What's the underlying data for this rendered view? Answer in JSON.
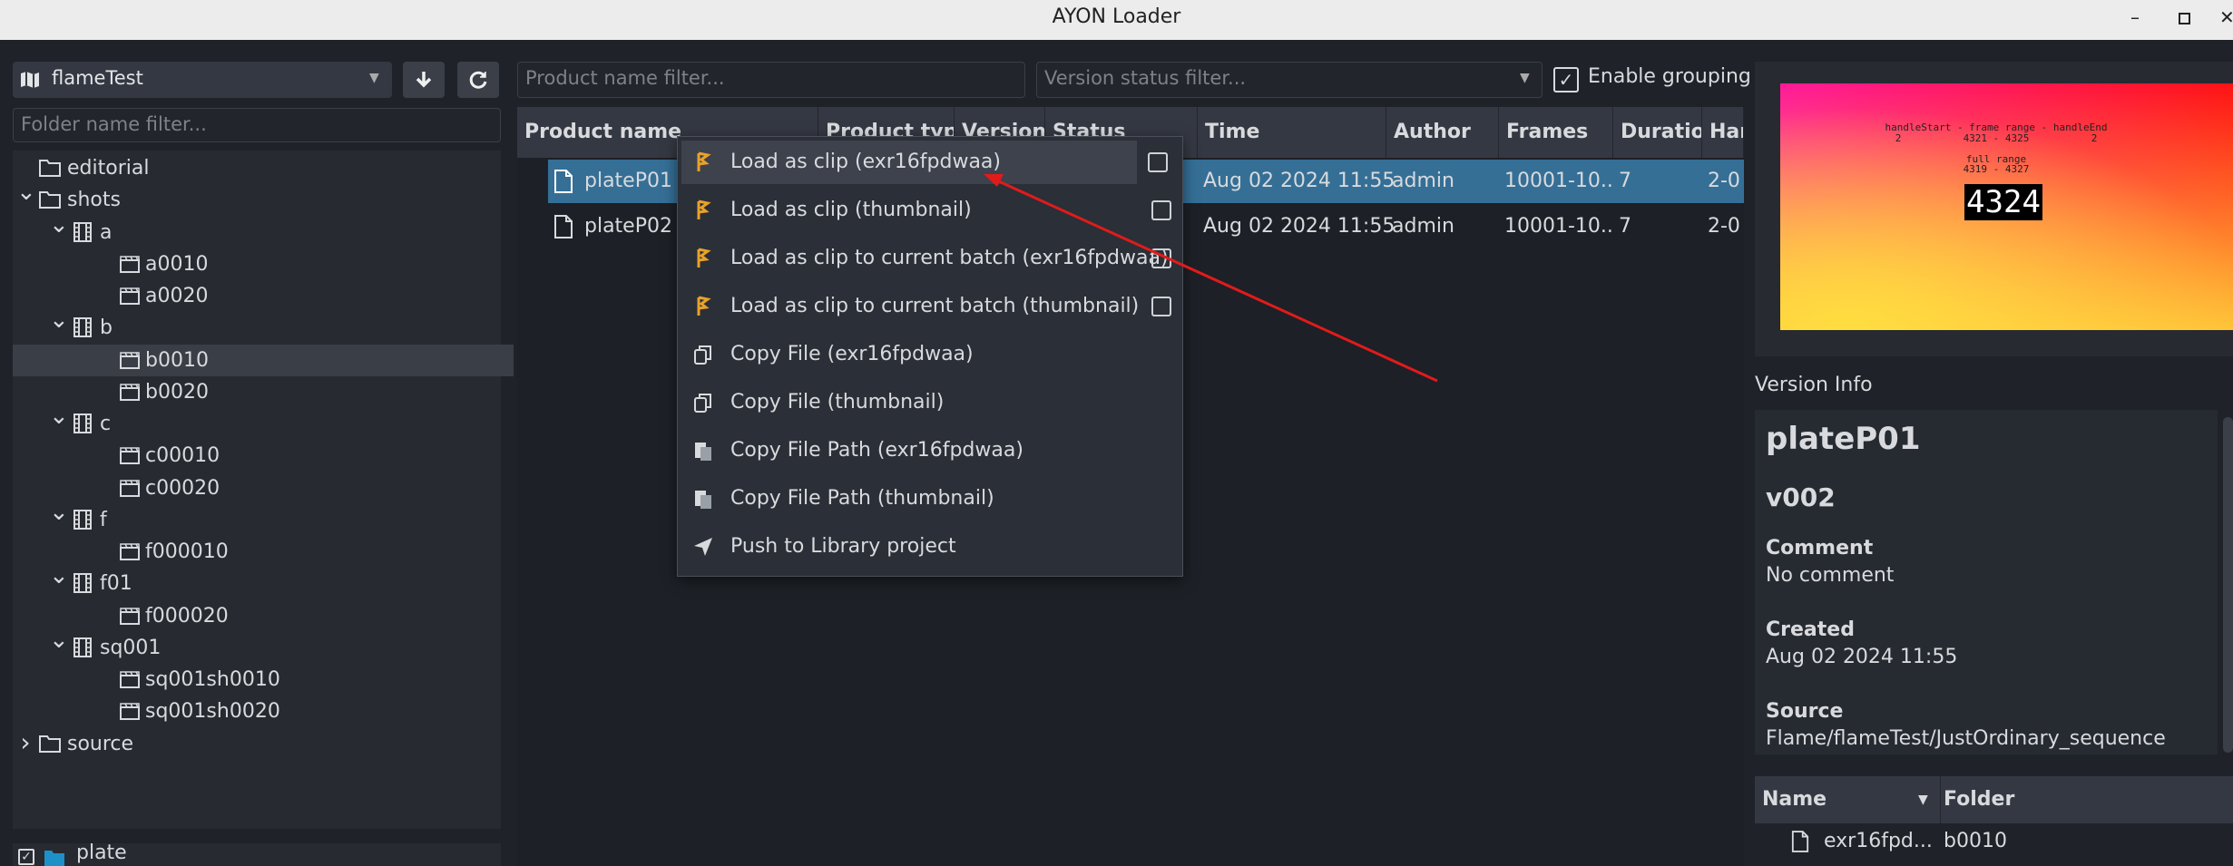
{
  "window": {
    "title": "AYON Loader"
  },
  "left": {
    "project_name": "flameTest",
    "folder_filter_placeholder": "Folder name filter...",
    "tree": [
      {
        "label": "editorial"
      },
      {
        "label": "shots"
      },
      {
        "label": "a"
      },
      {
        "label": "a0010"
      },
      {
        "label": "a0020"
      },
      {
        "label": "b"
      },
      {
        "label": "b0010"
      },
      {
        "label": "b0020"
      },
      {
        "label": "c"
      },
      {
        "label": "c00010"
      },
      {
        "label": "c00020"
      },
      {
        "label": "f"
      },
      {
        "label": "f000010"
      },
      {
        "label": "f01"
      },
      {
        "label": "f000020"
      },
      {
        "label": "sq001"
      },
      {
        "label": "sq001sh0010"
      },
      {
        "label": "sq001sh0020"
      },
      {
        "label": "source"
      }
    ],
    "type_filter": {
      "label": "plate"
    }
  },
  "center": {
    "product_filter_placeholder": "Product name filter...",
    "version_filter_placeholder": "Version status filter...",
    "enable_grouping_label": "Enable grouping",
    "columns": [
      "Product name",
      "Product type",
      "Version",
      "Status",
      "Time",
      "Author",
      "Frames",
      "Duration",
      "Handles"
    ],
    "rows": [
      {
        "name": "plateP01",
        "time": "Aug 02 2024 11:55",
        "author": "admin",
        "frames": "10001-10...",
        "duration": "7",
        "handles": "2-0"
      },
      {
        "name": "plateP02",
        "time": "Aug 02 2024 11:55",
        "author": "admin",
        "frames": "10001-10...",
        "duration": "7",
        "handles": "2-0"
      }
    ]
  },
  "context_menu": {
    "items": [
      {
        "label": "Load as clip (exr16fpdwaa)",
        "icon": "flame-icon"
      },
      {
        "label": "Load as clip (thumbnail)",
        "icon": "flame-icon"
      },
      {
        "label": "Load as clip to current batch (exr16fpdwaa)",
        "icon": "flame-icon"
      },
      {
        "label": "Load as clip to current batch (thumbnail)",
        "icon": "flame-icon"
      },
      {
        "label": "Copy File (exr16fpdwaa)",
        "icon": "copy-icon"
      },
      {
        "label": "Copy File (thumbnail)",
        "icon": "copy-icon"
      },
      {
        "label": "Copy File Path (exr16fpdwaa)",
        "icon": "clipboard-icon"
      },
      {
        "label": "Copy File Path (thumbnail)",
        "icon": "clipboard-icon"
      },
      {
        "label": "Push to Library project",
        "icon": "send-icon"
      }
    ],
    "accent_color": "#e8a22a"
  },
  "thumbnail": {
    "line1": "handleStart - frame range - handleEnd",
    "line2a": "2",
    "line2b": "4321 - 4325",
    "line2c": "2",
    "line3": "full range",
    "line4": "4319 - 4327",
    "frame": "4324"
  },
  "version_info": {
    "title": "Version Info",
    "product": "plateP01",
    "version": "v002",
    "comment_label": "Comment",
    "comment": "No comment",
    "created_label": "Created",
    "created": "Aug 02 2024 11:55",
    "source_label": "Source",
    "source": "Flame/flameTest/JustOrdinary_sequence"
  },
  "representations": {
    "columns": [
      "Name",
      "Folder"
    ],
    "rows": [
      {
        "name": "exr16fpd...",
        "folder": "b0010"
      }
    ]
  },
  "colors": {
    "selection": "#356f96",
    "annotation_arrow": "#e01b1b"
  }
}
